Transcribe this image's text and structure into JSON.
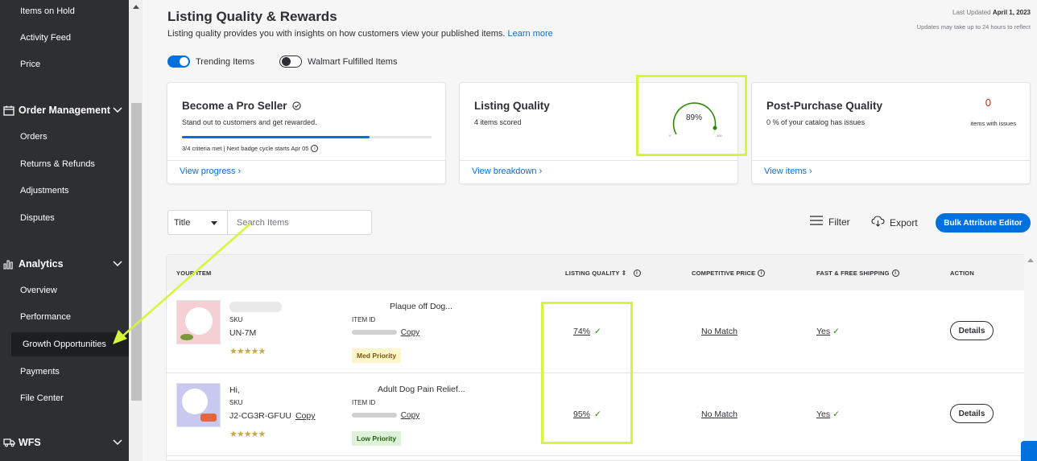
{
  "sidebar": {
    "top_items": [
      "Items on Hold",
      "Activity Feed",
      "Price"
    ],
    "order_section": "Order Management",
    "order_items": [
      "Orders",
      "Returns & Refunds",
      "Adjustments",
      "Disputes"
    ],
    "analytics_section": "Analytics",
    "analytics_items": [
      "Overview",
      "Performance",
      "Growth Opportunities",
      "Payments",
      "File Center"
    ],
    "wfs_section": "WFS"
  },
  "header": {
    "title": "Listing Quality & Rewards",
    "subtitle": "Listing quality provides you with insights on how customers view your published items.",
    "learn_more": "Learn more",
    "last_updated_label": "Last Updated",
    "last_updated_date": "April 1, 2023",
    "updates_note": "Updates may take up to 24 hours to reflect"
  },
  "toggles": {
    "trending": "Trending Items",
    "walmart_fulfilled": "Walmart Fulfilled Items"
  },
  "cards": {
    "pro_seller": {
      "title": "Become a Pro Seller",
      "desc": "Stand out to customers and get rewarded.",
      "criteria": "3/4 criteria met | Next badge cycle starts Apr 05",
      "progress": 0.75,
      "link": "View progress"
    },
    "listing_quality": {
      "title": "Listing Quality",
      "desc": "4 items scored",
      "score": "89%",
      "gauge_min": "0",
      "gauge_max": "100",
      "link": "View breakdown"
    },
    "post_purchase": {
      "title": "Post-Purchase Quality",
      "desc": "0 % of your catalog has issues",
      "issues_count": "0",
      "issues_label": "items with issues",
      "link": "View items"
    }
  },
  "search": {
    "select_value": "Title",
    "placeholder": "Search Items"
  },
  "toolbar": {
    "filter": "Filter",
    "export": "Export",
    "bulk": "Bulk Attribute Editor"
  },
  "table": {
    "headers": {
      "item": "YOUR ITEM",
      "lq": "LISTING QUALITY",
      "cp": "COMPETITIVE PRICE",
      "ship": "FAST & FREE SHIPPING",
      "action": "ACTION"
    },
    "rows": [
      {
        "name": "",
        "sku_label": "SKU",
        "sku": "UN-7M",
        "title": "Plaque off Dog...",
        "item_id_label": "ITEM ID",
        "item_id": "",
        "copy": "Copy",
        "priority": "Med Priority",
        "lq": "74%",
        "cp": "No Match",
        "ship": "Yes",
        "action": "Details"
      },
      {
        "name": "Hi,",
        "sku_label": "SKU",
        "sku": "J2-CG3R-GFUU",
        "title": "Adult Dog Pain Relief...",
        "item_id_label": "ITEM ID",
        "item_id": "",
        "copy": "Copy",
        "priority": "Low Priority",
        "lq": "95%",
        "cp": "No Match",
        "ship": "Yes",
        "action": "Details"
      }
    ]
  },
  "colors": {
    "accent": "#0071dc",
    "sidebar_bg": "#2e2f32",
    "highlight": "#d7f53a",
    "check": "#2a8703",
    "issue_red": "#de1c24"
  }
}
